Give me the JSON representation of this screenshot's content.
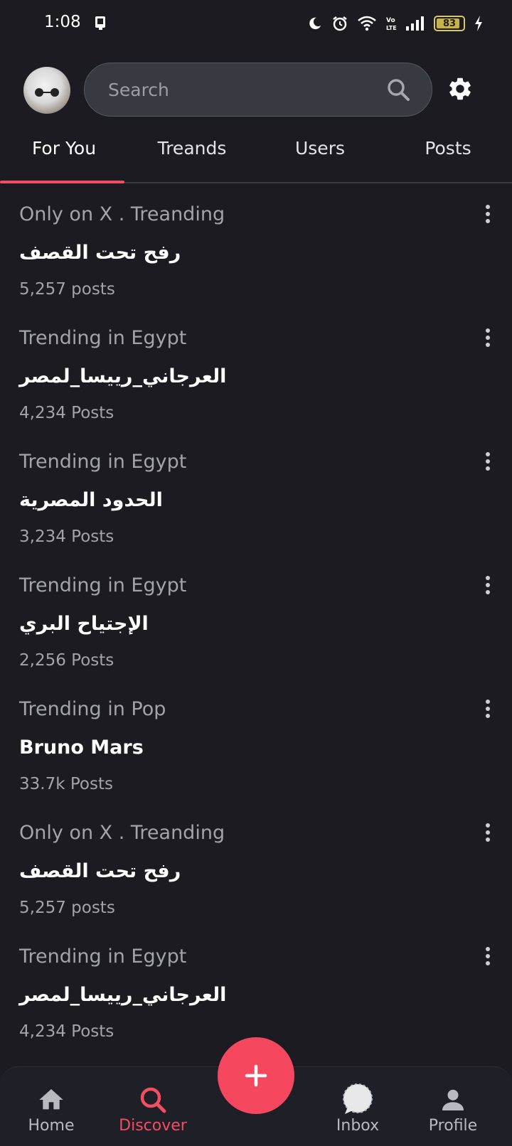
{
  "status_bar": {
    "time": "1:08",
    "battery": "83"
  },
  "header": {
    "search_placeholder": "Search"
  },
  "tabs": [
    {
      "label": "For You",
      "active": true
    },
    {
      "label": "Treands",
      "active": false
    },
    {
      "label": "Users",
      "active": false
    },
    {
      "label": "Posts",
      "active": false
    }
  ],
  "feed": [
    {
      "context": "Only on X . Treanding",
      "title": "رفح تحت القصف",
      "count": "5,257 posts"
    },
    {
      "context": "Trending in Egypt",
      "title": "العرجاني_رييسا_لمصر",
      "count": "4,234 Posts"
    },
    {
      "context": "Trending in Egypt",
      "title": "الحدود المصرية",
      "count": "3,234 Posts"
    },
    {
      "context": "Trending in Egypt",
      "title": "الإجتياح البري",
      "count": "2,256 Posts"
    },
    {
      "context": "Trending in Pop",
      "title": "Bruno Mars",
      "count": "33.7k Posts"
    },
    {
      "context": "Only on X . Treanding",
      "title": "رفح تحت القصف",
      "count": "5,257 posts"
    },
    {
      "context": "Trending in Egypt",
      "title": "العرجاني_رييسا_لمصر",
      "count": "4,234 Posts"
    }
  ],
  "bottom_nav": {
    "home": "Home",
    "discover": "Discover",
    "inbox": "Inbox",
    "profile": "Profile"
  },
  "colors": {
    "accent": "#f24d63",
    "background": "#1b1b21",
    "search_bg": "#383a42"
  }
}
